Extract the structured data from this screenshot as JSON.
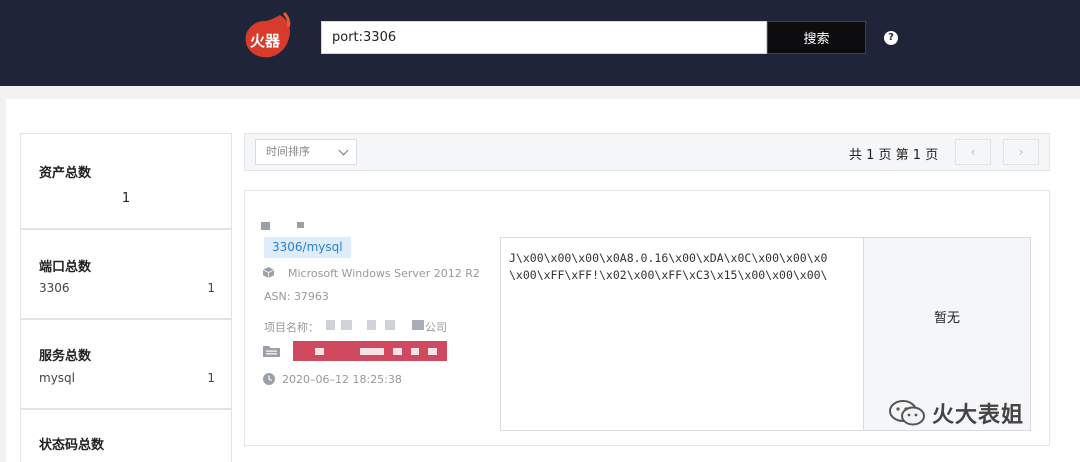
{
  "header": {
    "logo_text": "火器",
    "search_value": "port:3306",
    "search_button": "搜索",
    "help": "?"
  },
  "stats": {
    "assets": {
      "title": "资产总数",
      "value": "1"
    },
    "ports": {
      "title": "端口总数",
      "items": [
        {
          "name": "3306",
          "count": "1"
        }
      ]
    },
    "services": {
      "title": "服务总数",
      "items": [
        {
          "name": "mysql",
          "count": "1"
        }
      ]
    },
    "status_codes": {
      "title": "状态码总数"
    }
  },
  "toolbar": {
    "sort_label": "时间排序",
    "page_info": "共 1 页  第 1 页",
    "prev": "‹",
    "next": "›"
  },
  "result": {
    "service_tag": "3306/mysql",
    "os": "Microsoft Windows Server 2012 R2",
    "asn": "ASN: 37963",
    "project_label": "项目名称：",
    "project_suffix": "公司",
    "timestamp": "2020–06–12 18:25:38",
    "banner_line1": "J\\x00\\x00\\x00\\x0A8.0.16\\x00\\xDA\\x0C\\x00\\x00\\x0",
    "banner_line2": "\\x00\\xFF\\xFF!\\x02\\x00\\xFF\\xC3\\x15\\x00\\x00\\x00\\",
    "certificate": "暂无"
  },
  "watermark": {
    "text": "火大表姐"
  }
}
